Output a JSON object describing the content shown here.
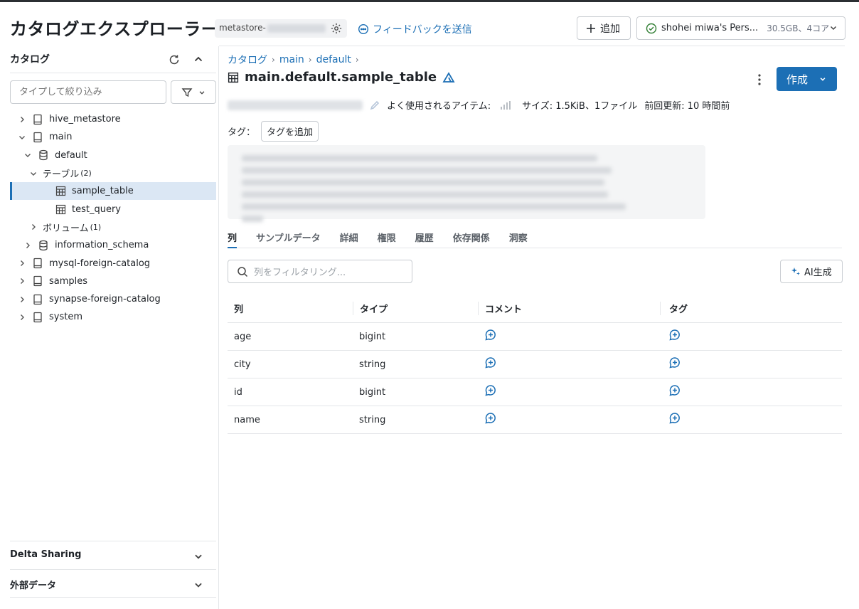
{
  "header": {
    "title": "カタログエクスプローラー",
    "metastore_prefix": "metastore-",
    "feedback": "フィードバックを送信",
    "add_label": "追加",
    "compute_name": "shohei miwa's Pers...",
    "compute_meta": "30.5GB、4コア"
  },
  "sidebar": {
    "title": "カタログ",
    "search_placeholder": "タイプして絞り込み",
    "tree": {
      "hive_metastore": "hive_metastore",
      "main": "main",
      "default": "default",
      "tables": "テーブル",
      "tables_count": "(2)",
      "sample_table": "sample_table",
      "test_query": "test_query",
      "volumes": "ボリューム",
      "volumes_count": "(1)",
      "information_schema": "information_schema",
      "mysql": "mysql-foreign-catalog",
      "samples": "samples",
      "synapse": "synapse-foreign-catalog",
      "system": "system"
    },
    "delta_sharing": "Delta Sharing",
    "external_data": "外部データ"
  },
  "main": {
    "breadcrumb": [
      "カタログ",
      "main",
      "default"
    ],
    "title": "main.default.sample_table",
    "create_label": "作成",
    "popular_label": "よく使用されるアイテム:",
    "size_label": "サイズ: 1.5KiB、1ファイル",
    "updated_label": "前回更新: 10 時間前",
    "tags_label": "タグ：",
    "add_tag_label": "タグを追加",
    "tabs": [
      "列",
      "サンプルデータ",
      "詳細",
      "権限",
      "履歴",
      "依存関係",
      "洞察"
    ],
    "column_filter_placeholder": "列をフィルタリング...",
    "ai_label": "AI生成",
    "table_headers": [
      "列",
      "タイプ",
      "コメント",
      "タグ"
    ],
    "columns": [
      {
        "name": "age",
        "type": "bigint"
      },
      {
        "name": "city",
        "type": "string"
      },
      {
        "name": "id",
        "type": "bigint"
      },
      {
        "name": "name",
        "type": "string"
      }
    ]
  },
  "colors": {
    "accent": "#1c6fb5",
    "selected_bg": "#dbe7f4"
  }
}
